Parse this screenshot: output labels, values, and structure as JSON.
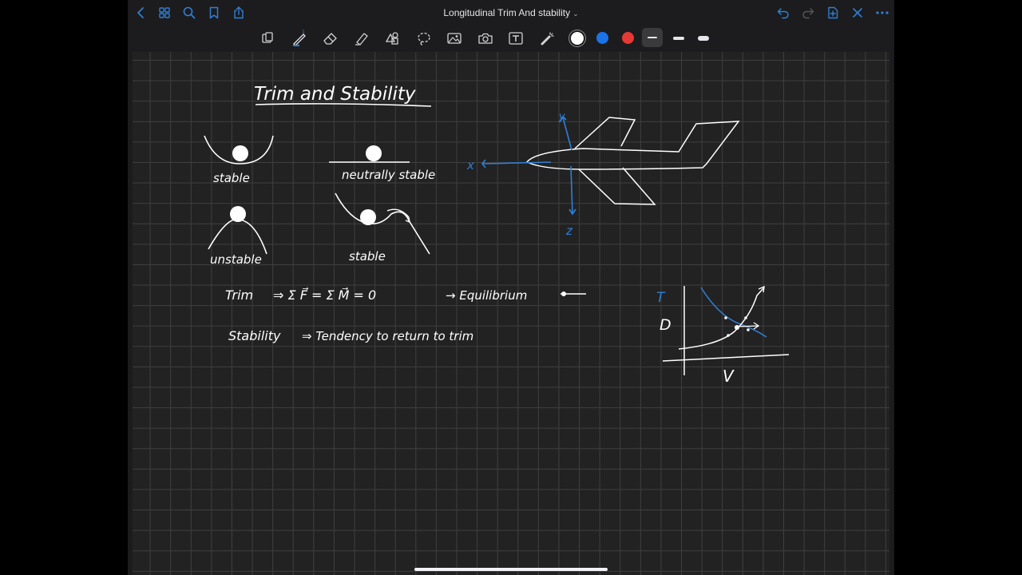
{
  "header": {
    "title": "Longitudinal Trim And stability",
    "title_chevron": "⌄",
    "left_icons": [
      "back-icon",
      "grid-icon",
      "search-icon",
      "bookmark-icon",
      "share-icon"
    ],
    "right_icons": [
      "undo-icon",
      "redo-icon",
      "add-page-icon",
      "close-icon",
      "more-icon"
    ]
  },
  "toolbar": {
    "tools": [
      "lasso-readonly-icon",
      "pen-icon",
      "eraser-icon",
      "highlighter-icon",
      "shapes-icon",
      "lasso-icon",
      "image-icon",
      "camera-icon",
      "text-icon",
      "laser-icon"
    ],
    "colors": [
      "#ffffff",
      "#1a73e8",
      "#e53935"
    ],
    "stroke_widths": [
      "thin",
      "medium",
      "thick"
    ]
  },
  "notes": {
    "title": "Trim and Stability",
    "stable": "stable",
    "neutrally_stable": "neutrally stable",
    "unstable": "unstable",
    "stable2": "stable",
    "trim_label": "Trim",
    "trim_eq": "⇒  Σ F⃗  =  Σ M⃗  = 0",
    "trim_result": "→  Equilibrium",
    "stability_label": "Stability",
    "stability_eq": "⇒  Tendency  to  return  to  trim",
    "axis_x": "x",
    "axis_y": "y",
    "axis_z": "z",
    "graph_t": "T",
    "graph_d": "D",
    "graph_v": "V"
  }
}
